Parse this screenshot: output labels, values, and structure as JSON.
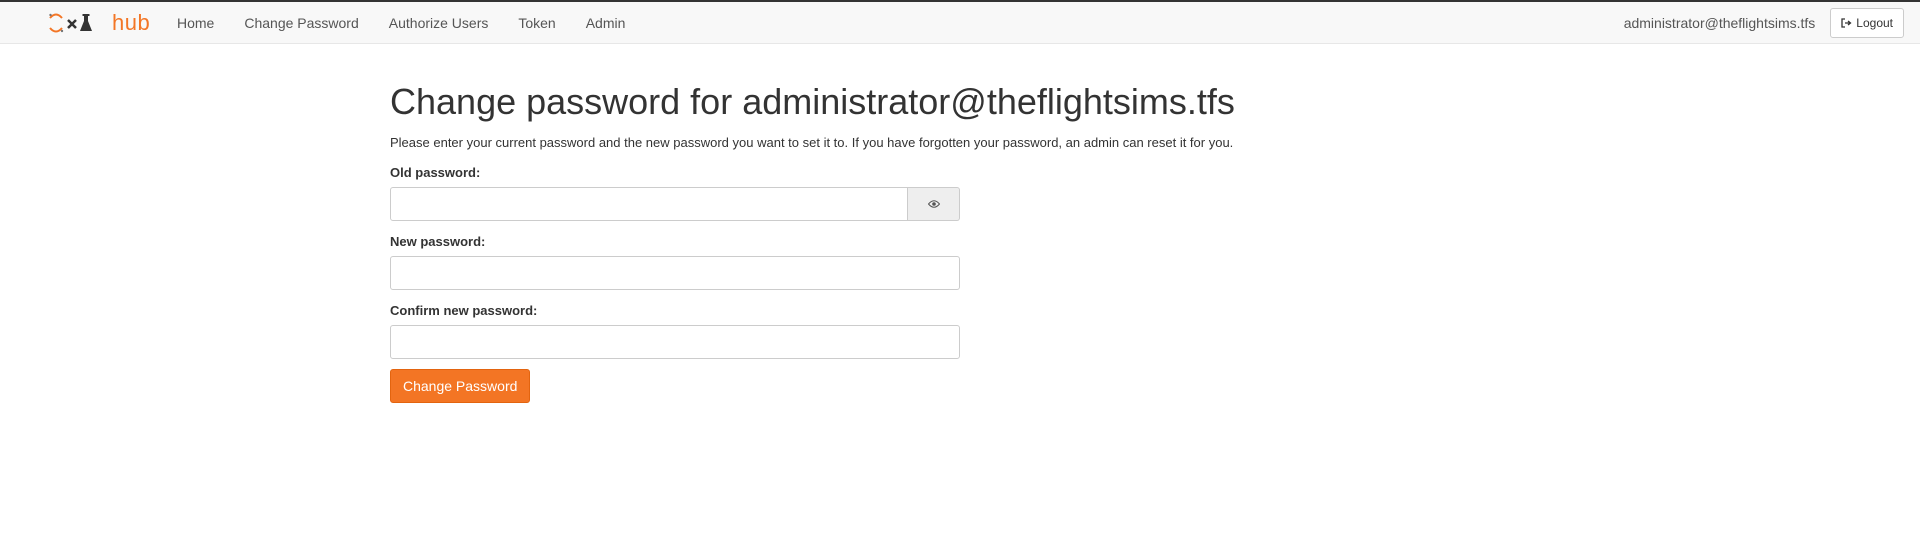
{
  "brand": {
    "logo_text": "hub",
    "accent_color": "#f37626"
  },
  "nav": {
    "items": [
      {
        "label": "Home"
      },
      {
        "label": "Change Password"
      },
      {
        "label": "Authorize Users"
      },
      {
        "label": "Token"
      },
      {
        "label": "Admin"
      }
    ],
    "user": "administrator@theflightsims.tfs",
    "logout_label": "Logout",
    "logout_icon": "sign-out-icon"
  },
  "main": {
    "title": "Change password for administrator@theflightsims.tfs",
    "description": "Please enter your current password and the new password you want to set it to. If you have forgotten your password, an admin can reset it for you.",
    "fields": {
      "old_password": {
        "label": "Old password:",
        "value": "",
        "toggle_icon": "eye-icon"
      },
      "new_password": {
        "label": "New password:",
        "value": ""
      },
      "confirm_password": {
        "label": "Confirm new password:",
        "value": ""
      }
    },
    "submit_label": "Change Password"
  }
}
